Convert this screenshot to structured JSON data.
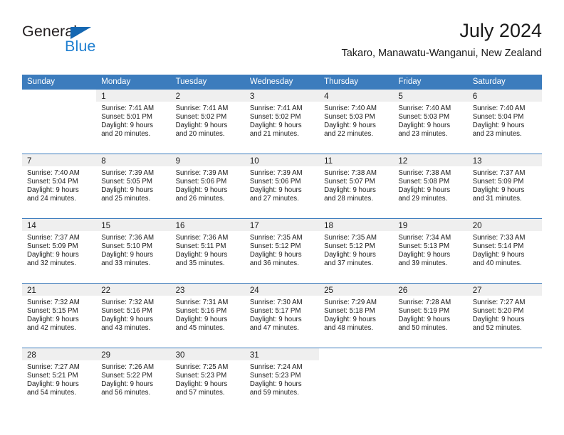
{
  "brand": {
    "name_part1": "General",
    "name_part2": "Blue",
    "triangle_color": "#1567b2",
    "blue_color": "#1f7fd0"
  },
  "header": {
    "title": "July 2024",
    "subtitle": "Takaro, Manawatu-Wanganui, New Zealand",
    "header_bg": "#3c7cbd",
    "daynum_bg": "#efefef"
  },
  "weekdays": [
    "Sunday",
    "Monday",
    "Tuesday",
    "Wednesday",
    "Thursday",
    "Friday",
    "Saturday"
  ],
  "weeks": [
    [
      {
        "day": "",
        "sunrise": "",
        "sunset": "",
        "daylight1": "",
        "daylight2": ""
      },
      {
        "day": "1",
        "sunrise": "Sunrise: 7:41 AM",
        "sunset": "Sunset: 5:01 PM",
        "daylight1": "Daylight: 9 hours",
        "daylight2": "and 20 minutes."
      },
      {
        "day": "2",
        "sunrise": "Sunrise: 7:41 AM",
        "sunset": "Sunset: 5:02 PM",
        "daylight1": "Daylight: 9 hours",
        "daylight2": "and 20 minutes."
      },
      {
        "day": "3",
        "sunrise": "Sunrise: 7:41 AM",
        "sunset": "Sunset: 5:02 PM",
        "daylight1": "Daylight: 9 hours",
        "daylight2": "and 21 minutes."
      },
      {
        "day": "4",
        "sunrise": "Sunrise: 7:40 AM",
        "sunset": "Sunset: 5:03 PM",
        "daylight1": "Daylight: 9 hours",
        "daylight2": "and 22 minutes."
      },
      {
        "day": "5",
        "sunrise": "Sunrise: 7:40 AM",
        "sunset": "Sunset: 5:03 PM",
        "daylight1": "Daylight: 9 hours",
        "daylight2": "and 23 minutes."
      },
      {
        "day": "6",
        "sunrise": "Sunrise: 7:40 AM",
        "sunset": "Sunset: 5:04 PM",
        "daylight1": "Daylight: 9 hours",
        "daylight2": "and 23 minutes."
      }
    ],
    [
      {
        "day": "7",
        "sunrise": "Sunrise: 7:40 AM",
        "sunset": "Sunset: 5:04 PM",
        "daylight1": "Daylight: 9 hours",
        "daylight2": "and 24 minutes."
      },
      {
        "day": "8",
        "sunrise": "Sunrise: 7:39 AM",
        "sunset": "Sunset: 5:05 PM",
        "daylight1": "Daylight: 9 hours",
        "daylight2": "and 25 minutes."
      },
      {
        "day": "9",
        "sunrise": "Sunrise: 7:39 AM",
        "sunset": "Sunset: 5:06 PM",
        "daylight1": "Daylight: 9 hours",
        "daylight2": "and 26 minutes."
      },
      {
        "day": "10",
        "sunrise": "Sunrise: 7:39 AM",
        "sunset": "Sunset: 5:06 PM",
        "daylight1": "Daylight: 9 hours",
        "daylight2": "and 27 minutes."
      },
      {
        "day": "11",
        "sunrise": "Sunrise: 7:38 AM",
        "sunset": "Sunset: 5:07 PM",
        "daylight1": "Daylight: 9 hours",
        "daylight2": "and 28 minutes."
      },
      {
        "day": "12",
        "sunrise": "Sunrise: 7:38 AM",
        "sunset": "Sunset: 5:08 PM",
        "daylight1": "Daylight: 9 hours",
        "daylight2": "and 29 minutes."
      },
      {
        "day": "13",
        "sunrise": "Sunrise: 7:37 AM",
        "sunset": "Sunset: 5:09 PM",
        "daylight1": "Daylight: 9 hours",
        "daylight2": "and 31 minutes."
      }
    ],
    [
      {
        "day": "14",
        "sunrise": "Sunrise: 7:37 AM",
        "sunset": "Sunset: 5:09 PM",
        "daylight1": "Daylight: 9 hours",
        "daylight2": "and 32 minutes."
      },
      {
        "day": "15",
        "sunrise": "Sunrise: 7:36 AM",
        "sunset": "Sunset: 5:10 PM",
        "daylight1": "Daylight: 9 hours",
        "daylight2": "and 33 minutes."
      },
      {
        "day": "16",
        "sunrise": "Sunrise: 7:36 AM",
        "sunset": "Sunset: 5:11 PM",
        "daylight1": "Daylight: 9 hours",
        "daylight2": "and 35 minutes."
      },
      {
        "day": "17",
        "sunrise": "Sunrise: 7:35 AM",
        "sunset": "Sunset: 5:12 PM",
        "daylight1": "Daylight: 9 hours",
        "daylight2": "and 36 minutes."
      },
      {
        "day": "18",
        "sunrise": "Sunrise: 7:35 AM",
        "sunset": "Sunset: 5:12 PM",
        "daylight1": "Daylight: 9 hours",
        "daylight2": "and 37 minutes."
      },
      {
        "day": "19",
        "sunrise": "Sunrise: 7:34 AM",
        "sunset": "Sunset: 5:13 PM",
        "daylight1": "Daylight: 9 hours",
        "daylight2": "and 39 minutes."
      },
      {
        "day": "20",
        "sunrise": "Sunrise: 7:33 AM",
        "sunset": "Sunset: 5:14 PM",
        "daylight1": "Daylight: 9 hours",
        "daylight2": "and 40 minutes."
      }
    ],
    [
      {
        "day": "21",
        "sunrise": "Sunrise: 7:32 AM",
        "sunset": "Sunset: 5:15 PM",
        "daylight1": "Daylight: 9 hours",
        "daylight2": "and 42 minutes."
      },
      {
        "day": "22",
        "sunrise": "Sunrise: 7:32 AM",
        "sunset": "Sunset: 5:16 PM",
        "daylight1": "Daylight: 9 hours",
        "daylight2": "and 43 minutes."
      },
      {
        "day": "23",
        "sunrise": "Sunrise: 7:31 AM",
        "sunset": "Sunset: 5:16 PM",
        "daylight1": "Daylight: 9 hours",
        "daylight2": "and 45 minutes."
      },
      {
        "day": "24",
        "sunrise": "Sunrise: 7:30 AM",
        "sunset": "Sunset: 5:17 PM",
        "daylight1": "Daylight: 9 hours",
        "daylight2": "and 47 minutes."
      },
      {
        "day": "25",
        "sunrise": "Sunrise: 7:29 AM",
        "sunset": "Sunset: 5:18 PM",
        "daylight1": "Daylight: 9 hours",
        "daylight2": "and 48 minutes."
      },
      {
        "day": "26",
        "sunrise": "Sunrise: 7:28 AM",
        "sunset": "Sunset: 5:19 PM",
        "daylight1": "Daylight: 9 hours",
        "daylight2": "and 50 minutes."
      },
      {
        "day": "27",
        "sunrise": "Sunrise: 7:27 AM",
        "sunset": "Sunset: 5:20 PM",
        "daylight1": "Daylight: 9 hours",
        "daylight2": "and 52 minutes."
      }
    ],
    [
      {
        "day": "28",
        "sunrise": "Sunrise: 7:27 AM",
        "sunset": "Sunset: 5:21 PM",
        "daylight1": "Daylight: 9 hours",
        "daylight2": "and 54 minutes."
      },
      {
        "day": "29",
        "sunrise": "Sunrise: 7:26 AM",
        "sunset": "Sunset: 5:22 PM",
        "daylight1": "Daylight: 9 hours",
        "daylight2": "and 56 minutes."
      },
      {
        "day": "30",
        "sunrise": "Sunrise: 7:25 AM",
        "sunset": "Sunset: 5:23 PM",
        "daylight1": "Daylight: 9 hours",
        "daylight2": "and 57 minutes."
      },
      {
        "day": "31",
        "sunrise": "Sunrise: 7:24 AM",
        "sunset": "Sunset: 5:23 PM",
        "daylight1": "Daylight: 9 hours",
        "daylight2": "and 59 minutes."
      },
      {
        "day": "",
        "sunrise": "",
        "sunset": "",
        "daylight1": "",
        "daylight2": ""
      },
      {
        "day": "",
        "sunrise": "",
        "sunset": "",
        "daylight1": "",
        "daylight2": ""
      },
      {
        "day": "",
        "sunrise": "",
        "sunset": "",
        "daylight1": "",
        "daylight2": ""
      }
    ]
  ]
}
